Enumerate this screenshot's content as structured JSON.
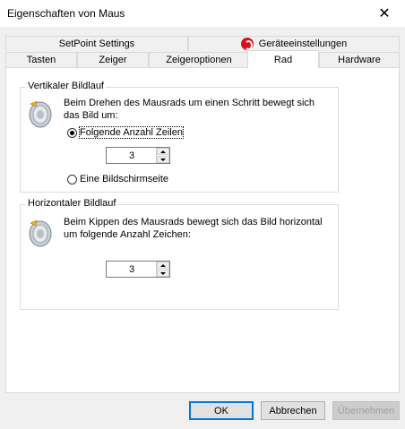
{
  "window": {
    "title": "Eigenschaften von Maus",
    "close_icon": "close-icon"
  },
  "tabs_row_back": [
    {
      "label": "SetPoint Settings"
    },
    {
      "label": "Geräteeinstellungen",
      "icon": "logitech-logo-icon"
    }
  ],
  "tabs_row_front": [
    {
      "label": "Tasten"
    },
    {
      "label": "Zeiger"
    },
    {
      "label": "Zeigeroptionen"
    },
    {
      "label": "Rad",
      "selected": true
    },
    {
      "label": "Hardware"
    }
  ],
  "vertical": {
    "group_title": "Vertikaler Bildlauf",
    "description_line1": "Beim Drehen des Mausrads um einen Schritt bewegt sich",
    "description_line2": "das Bild um:",
    "option_lines": "Folgende Anzahl Zeilen",
    "option_lines_checked": true,
    "lines_value": "3",
    "option_page": "Eine Bildschirmseite",
    "option_page_checked": false
  },
  "horizontal": {
    "group_title": "Horizontaler Bildlauf",
    "description_line1": "Beim Kippen des Mausrads bewegt sich das Bild horizontal",
    "description_line2": "um folgende Anzahl Zeichen:",
    "chars_value": "3"
  },
  "buttons": {
    "ok": "OK",
    "cancel": "Abbrechen",
    "apply": "Übernehmen"
  }
}
